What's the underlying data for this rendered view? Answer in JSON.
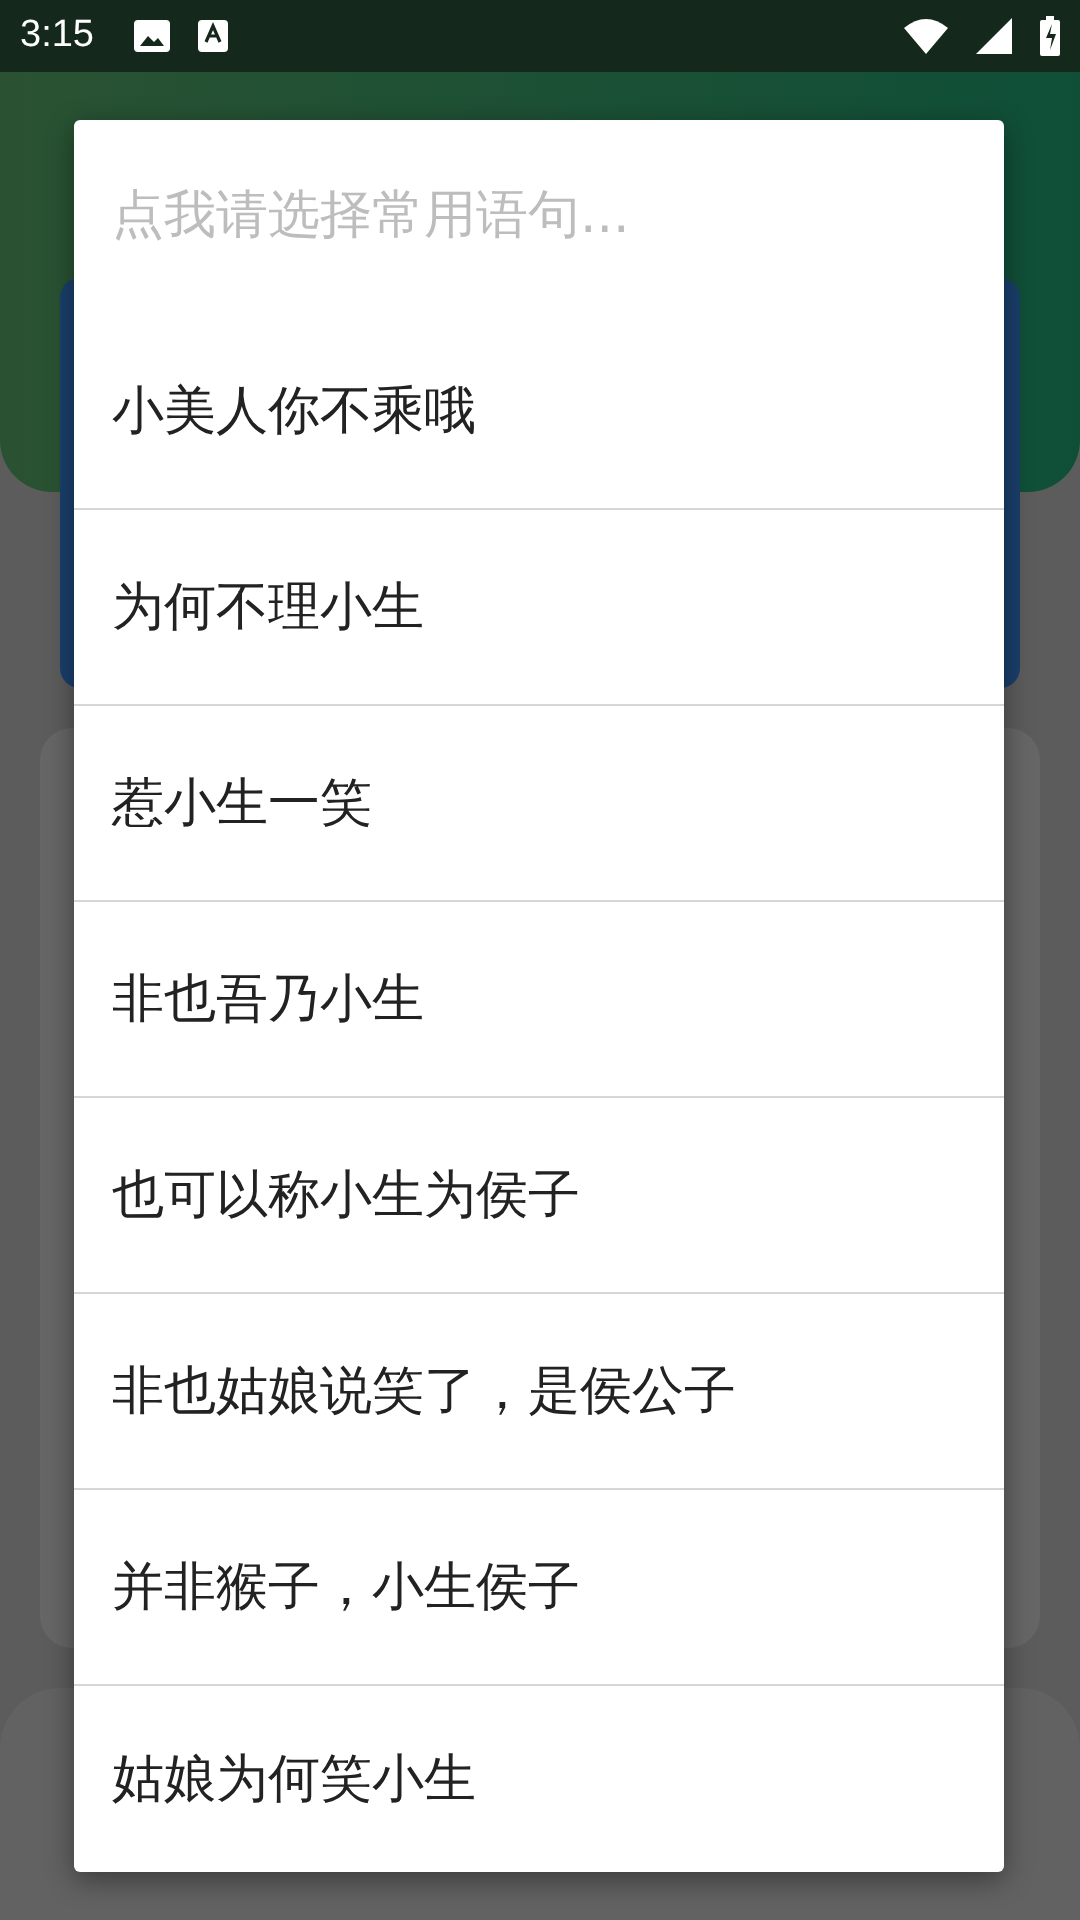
{
  "status_bar": {
    "time": "3:15"
  },
  "dialog": {
    "prompt": "点我请选择常用语句...",
    "items": [
      {
        "label": "小美人你不乘哦"
      },
      {
        "label": "为何不理小生"
      },
      {
        "label": "惹小生一笑"
      },
      {
        "label": "非也吾乃小生"
      },
      {
        "label": "也可以称小生为侯子"
      },
      {
        "label": "非也姑娘说笑了，是侯公子"
      },
      {
        "label": "并非猴子，小生侯子"
      },
      {
        "label": "姑娘为何笑小生"
      }
    ]
  }
}
